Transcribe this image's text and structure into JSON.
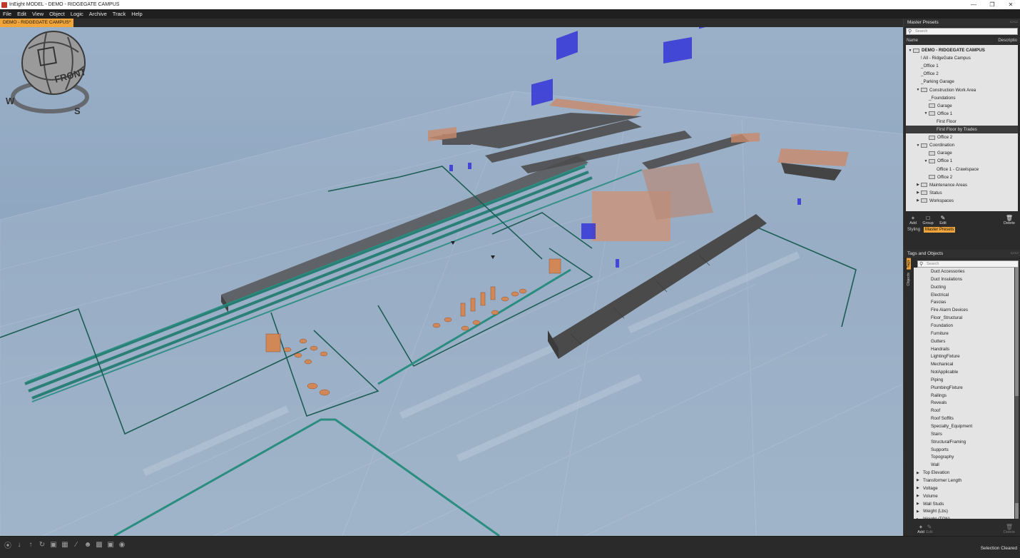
{
  "window": {
    "title": "InEight MODEL - DEMO - RIDGEGATE CAMPUS"
  },
  "menu": [
    "File",
    "Edit",
    "View",
    "Object",
    "Logic",
    "Archive",
    "Track",
    "Help"
  ],
  "doc_tab": {
    "label": "DEMO - RIDGEGATE CAMPUS*"
  },
  "compass": {
    "front": "FRONT",
    "west": "W",
    "south": "S"
  },
  "master_presets": {
    "title": "Master Presets",
    "search_placeholder": "Search",
    "columns": {
      "name": "Name",
      "description": "Descriptio"
    },
    "tree": [
      {
        "label": "DEMO - RIDGEGATE CAMPUS",
        "depth": 0,
        "arrow": "down",
        "folder": true,
        "bold": true
      },
      {
        "label": "! All - RidgeGate Campus",
        "depth": 1,
        "arrow": "",
        "folder": false
      },
      {
        "label": "_Office 1",
        "depth": 1,
        "arrow": "",
        "folder": false
      },
      {
        "label": "_Office 2",
        "depth": 1,
        "arrow": "",
        "folder": false
      },
      {
        "label": "_Parking Garage",
        "depth": 1,
        "arrow": "",
        "folder": false
      },
      {
        "label": "Construction Work Area",
        "depth": 1,
        "arrow": "down",
        "folder": true
      },
      {
        "label": "_Foundations",
        "depth": 2,
        "arrow": "",
        "folder": false
      },
      {
        "label": "Garage",
        "depth": 2,
        "arrow": "",
        "folder": true
      },
      {
        "label": "Office 1",
        "depth": 2,
        "arrow": "down",
        "folder": true
      },
      {
        "label": "First Floor",
        "depth": 3,
        "arrow": "",
        "folder": false
      },
      {
        "label": "First Floor by Trades",
        "depth": 3,
        "arrow": "",
        "folder": false,
        "selected": true
      },
      {
        "label": "Office 2",
        "depth": 2,
        "arrow": "",
        "folder": true
      },
      {
        "label": "Coordination",
        "depth": 1,
        "arrow": "down",
        "folder": true
      },
      {
        "label": "Garage",
        "depth": 2,
        "arrow": "",
        "folder": true
      },
      {
        "label": "Office 1",
        "depth": 2,
        "arrow": "down",
        "folder": true
      },
      {
        "label": "Office 1 - Crawlspace",
        "depth": 3,
        "arrow": "",
        "folder": false
      },
      {
        "label": "Office 2",
        "depth": 2,
        "arrow": "",
        "folder": true
      },
      {
        "label": "Maintenance Areas",
        "depth": 1,
        "arrow": "right",
        "folder": true
      },
      {
        "label": "Status",
        "depth": 1,
        "arrow": "right",
        "folder": true
      },
      {
        "label": "Workspaces",
        "depth": 1,
        "arrow": "right",
        "folder": true
      }
    ],
    "tools": {
      "add": "Add",
      "group": "Group",
      "edit": "Edit",
      "delete": "Delete"
    },
    "tabs": {
      "styling": "Styling",
      "master_presets": "Master Presets"
    }
  },
  "tags_objects": {
    "title": "Tags and Objects",
    "side_tabs": {
      "tags": "Tags",
      "objects": "Objects"
    },
    "search_placeholder": "Search",
    "items": [
      {
        "label": "Duct Accessories",
        "depth": 2
      },
      {
        "label": "Duct Insulations",
        "depth": 2
      },
      {
        "label": "Ducting",
        "depth": 2
      },
      {
        "label": "Electrical",
        "depth": 2
      },
      {
        "label": "Fascias",
        "depth": 2
      },
      {
        "label": "Fire Alarm Devices",
        "depth": 2
      },
      {
        "label": "Floor_Structural",
        "depth": 2
      },
      {
        "label": "Foundation",
        "depth": 2
      },
      {
        "label": "Furniture",
        "depth": 2
      },
      {
        "label": "Gutters",
        "depth": 2
      },
      {
        "label": "Handrails",
        "depth": 2
      },
      {
        "label": "LightingFixture",
        "depth": 2
      },
      {
        "label": "Mechanical",
        "depth": 2
      },
      {
        "label": "NotApplicable",
        "depth": 2
      },
      {
        "label": "Piping",
        "depth": 2
      },
      {
        "label": "PlumbingFixture",
        "depth": 2
      },
      {
        "label": "Railings",
        "depth": 2
      },
      {
        "label": "Reveals",
        "depth": 2
      },
      {
        "label": "Roof",
        "depth": 2
      },
      {
        "label": "Roof Soffits",
        "depth": 2
      },
      {
        "label": "Specialty_Equipment",
        "depth": 2
      },
      {
        "label": "Stairs",
        "depth": 2
      },
      {
        "label": "StructuralFraming",
        "depth": 2
      },
      {
        "label": "Supports",
        "depth": 2
      },
      {
        "label": "Topography",
        "depth": 2
      },
      {
        "label": "Wall",
        "depth": 2
      },
      {
        "label": "Top Elevation",
        "depth": 1,
        "arrow": true
      },
      {
        "label": "Transformer Length",
        "depth": 1,
        "arrow": true
      },
      {
        "label": "Voltage",
        "depth": 1,
        "arrow": true
      },
      {
        "label": "Volume",
        "depth": 1,
        "arrow": true
      },
      {
        "label": "Wall Studs",
        "depth": 1,
        "arrow": true
      },
      {
        "label": "Weight (Lbs)",
        "depth": 1,
        "arrow": true
      },
      {
        "label": "Weight (TON)",
        "depth": 1,
        "arrow": true
      }
    ],
    "tools": {
      "add": "Add",
      "edit": "Edit",
      "delete": "Delete"
    }
  },
  "status_bar": {
    "message": "Selection Cleared"
  },
  "colors": {
    "accent": "#f0a43a",
    "pipe": "#1f7a6e",
    "equipment": "#3a3ae0",
    "fixture": "#d9834a",
    "sky": "#9ab0c8"
  }
}
